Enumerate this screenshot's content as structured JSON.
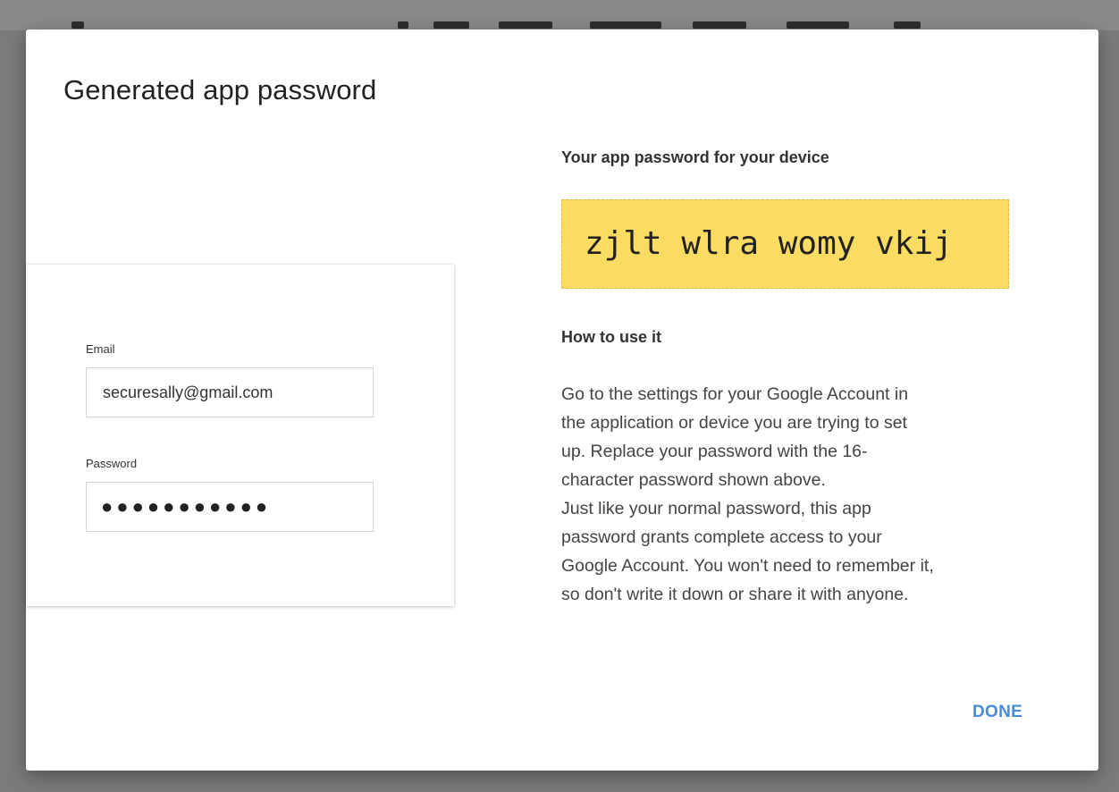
{
  "dialog": {
    "title": "Generated app password"
  },
  "login_card": {
    "email_label": "Email",
    "email_value": "securesally@gmail.com",
    "password_label": "Password",
    "password_value": "●●●●●●●●●●●"
  },
  "app_password": {
    "heading": "Your app password for your device",
    "value": "zjlt wlra womy vkij",
    "box_color": "#fbdc63"
  },
  "how_to": {
    "heading": "How to use it",
    "lines": [
      "Go to the settings for your Google Account in",
      "the application or device you are trying to set",
      "up. Replace your password with the 16-",
      "character password shown above.",
      "Just like your normal password, this app",
      "password grants complete access to your",
      "Google Account. You won't need to remember it,",
      "so don't write it down or share it with anyone."
    ]
  },
  "actions": {
    "done_label": "DONE",
    "accent_color": "#4a8bd6"
  }
}
